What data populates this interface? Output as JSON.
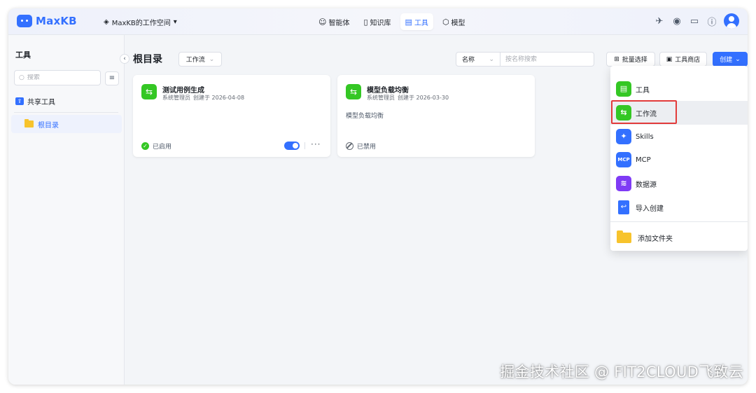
{
  "app": {
    "brand": "MaxKB",
    "workspace": "MaxKB的工作空间",
    "brand_color": "#3370ff"
  },
  "nav": {
    "items": [
      {
        "label": "智能体",
        "icon": "robot-icon"
      },
      {
        "label": "知识库",
        "icon": "book-icon"
      },
      {
        "label": "工具",
        "icon": "toolbox-icon",
        "active": true
      },
      {
        "label": "模型",
        "icon": "cube-icon"
      }
    ]
  },
  "top_icons": [
    "model-icon",
    "github-icon",
    "docs-icon",
    "help-icon",
    "avatar"
  ],
  "sidebar": {
    "title": "工具",
    "search_placeholder": "搜索",
    "shared": "共享工具",
    "root": "根目录"
  },
  "main": {
    "title": "根目录",
    "type_filter": "工作流",
    "filter_field": "名称",
    "filter_placeholder": "按名称搜索",
    "batch_select": "批量选择",
    "tool_store": "工具商店",
    "create": "创建"
  },
  "cards": [
    {
      "title": "测试用例生成",
      "author": "系统管理员",
      "created": "创建于 2026-04-08",
      "desc": "",
      "status": "已启用",
      "enabled": true
    },
    {
      "title": "模型负载均衡",
      "author": "系统管理员",
      "created": "创建于 2026-03-30",
      "desc": "模型负载均衡",
      "status": "已禁用",
      "enabled": false
    }
  ],
  "create_menu": {
    "items": [
      {
        "label": "工具",
        "icon": "toolbox-icon"
      },
      {
        "label": "工作流",
        "icon": "workflow-icon",
        "highlighted": true
      },
      {
        "label": "Skills",
        "icon": "sparkle-icon"
      },
      {
        "label": "MCP",
        "icon": "mcp-icon"
      },
      {
        "label": "数据源",
        "icon": "database-icon"
      },
      {
        "label": "导入创建",
        "icon": "import-file-icon"
      }
    ],
    "add_folder": "添加文件夹"
  },
  "watermark": "掘金技术社区 @ FIT2CLOUD飞致云"
}
